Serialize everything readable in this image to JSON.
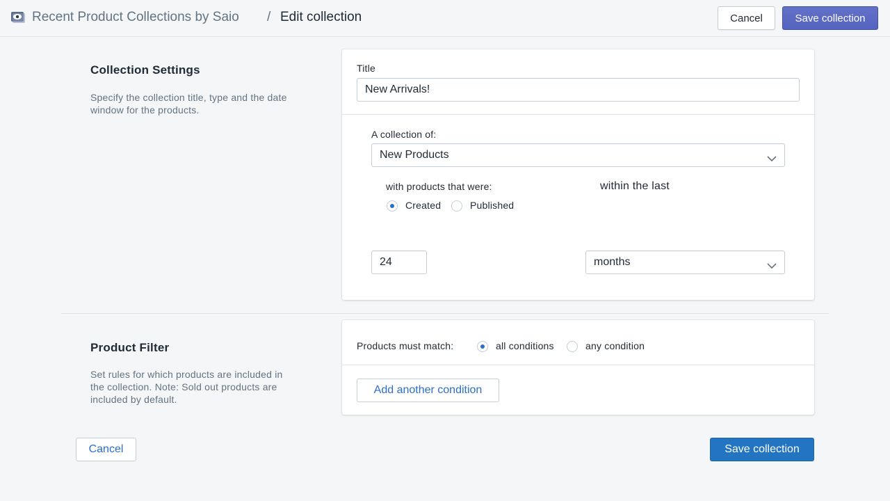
{
  "header": {
    "app_name": "Recent Product Collections by Saio",
    "separator": "/",
    "page_title": "Edit collection",
    "cancel_label": "Cancel",
    "save_label": "Save collection",
    "app_icon": "app-logo-icon"
  },
  "settings": {
    "heading": "Collection Settings",
    "description": "Specify the collection title, type and the date window for the products.",
    "title_label": "Title",
    "title_value": "New Arrivals!",
    "collection_of_label": "A collection of:",
    "collection_of_value": "New Products",
    "with_products_label": "with products that were:",
    "within_label": "within the last",
    "radio_created": "Created",
    "radio_published": "Published",
    "selected_mode": "Created",
    "amount_value": "24",
    "unit_value": "months"
  },
  "filter": {
    "heading": "Product Filter",
    "description": "Set rules for which products are included in the collection. Note: Sold out products are included by default.",
    "match_label": "Products must match:",
    "radio_all": "all conditions",
    "radio_any": "any condition",
    "selected_match": "all conditions",
    "add_condition_label": "Add another condition"
  },
  "footer": {
    "cancel_label": "Cancel",
    "save_label": "Save collection"
  },
  "colors": {
    "accent_indigo": "#5c6ac4",
    "primary_blue": "#2375c1",
    "link_blue": "#2c6ecb",
    "background": "#f4f6f8"
  }
}
